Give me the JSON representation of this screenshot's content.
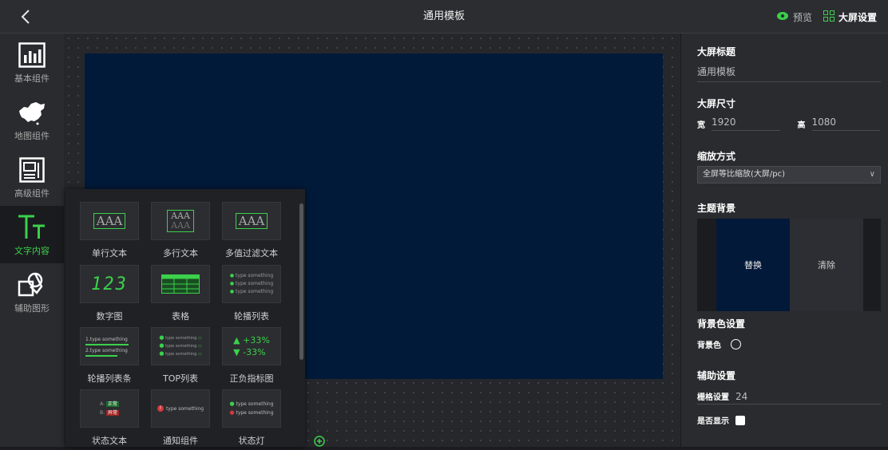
{
  "header": {
    "title": "通用模板",
    "preview_label": "预览",
    "screen_settings_label": "大屏设置",
    "accent": "#3bd14b"
  },
  "sidebar": {
    "items": [
      {
        "label": "基本组件",
        "icon": "bar-chart-icon"
      },
      {
        "label": "地图组件",
        "icon": "china-map-icon"
      },
      {
        "label": "高级组件",
        "icon": "advanced-component-icon"
      },
      {
        "label": "文字内容",
        "icon": "text-content-icon",
        "active": true
      },
      {
        "label": "辅助图形",
        "icon": "shapes-icon"
      }
    ]
  },
  "text_panel": {
    "items": [
      {
        "label": "单行文本",
        "sample": "AAA"
      },
      {
        "label": "多行文本",
        "sample_1": "AAA",
        "sample_2": "AAA"
      },
      {
        "label": "多值过滤文本",
        "sample": "AAA"
      },
      {
        "label": "数字图",
        "sample": "123"
      },
      {
        "label": "表格"
      },
      {
        "label": "轮播列表",
        "row": "type something"
      },
      {
        "label": "轮播列表条",
        "row_1": "1.type something",
        "row_2": "2.type something"
      },
      {
        "label": "TOP列表",
        "row": "type something"
      },
      {
        "label": "正负指标图",
        "up": "+33%",
        "down": "-33%"
      },
      {
        "label": "状态文本",
        "a_key": "A:",
        "a_val": "正常",
        "b_key": "B:",
        "b_val": "异常"
      },
      {
        "label": "通知组件",
        "text": "type something"
      },
      {
        "label": "状态灯",
        "text": "type something"
      }
    ]
  },
  "settings": {
    "screen_title": {
      "heading": "大屏标题",
      "value": "通用模板"
    },
    "screen_size": {
      "heading": "大屏尺寸",
      "width_label": "宽",
      "width": "1920",
      "height_label": "高",
      "height": "1080"
    },
    "scale_mode": {
      "heading": "缩放方式",
      "value": "全屏等比缩放(大屏/pc)"
    },
    "theme_bg": {
      "heading": "主题背景",
      "replace": "替换",
      "clear": "清除"
    },
    "bg_color": {
      "heading": "背景色设置",
      "label": "背景色"
    },
    "aux": {
      "heading": "辅助设置",
      "grid_label": "栅格设置",
      "grid_value": "24",
      "show_label": "是否显示"
    }
  }
}
